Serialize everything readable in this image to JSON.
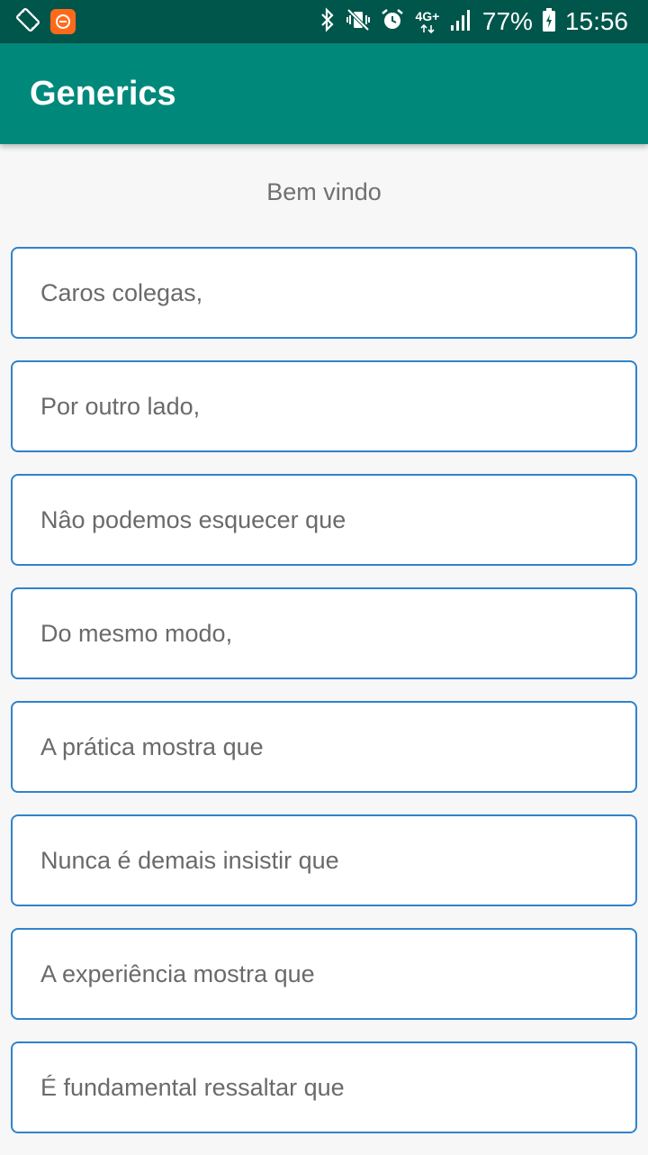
{
  "status_bar": {
    "battery": "77%",
    "time": "15:56",
    "network": "4G+",
    "icons": [
      "screen-rotation-icon",
      "app-notification-icon",
      "bluetooth-icon",
      "vibrate-off-icon",
      "alarm-icon",
      "4g-icon",
      "signal-icon",
      "battery-charging-icon"
    ]
  },
  "toolbar": {
    "title": "Generics"
  },
  "main": {
    "welcome": "Bem vindo",
    "phrases": [
      "Caros colegas,",
      "Por outro lado,",
      "Nâo podemos esquecer que",
      "Do mesmo modo,",
      "A prática mostra que",
      "Nunca é demais insistir que",
      "A experiência mostra que",
      "É fundamental ressaltar que"
    ]
  },
  "colors": {
    "status_bar": "#00564b",
    "toolbar": "#00897b",
    "button_border": "#2f83cc",
    "background": "#f7f7f7"
  }
}
